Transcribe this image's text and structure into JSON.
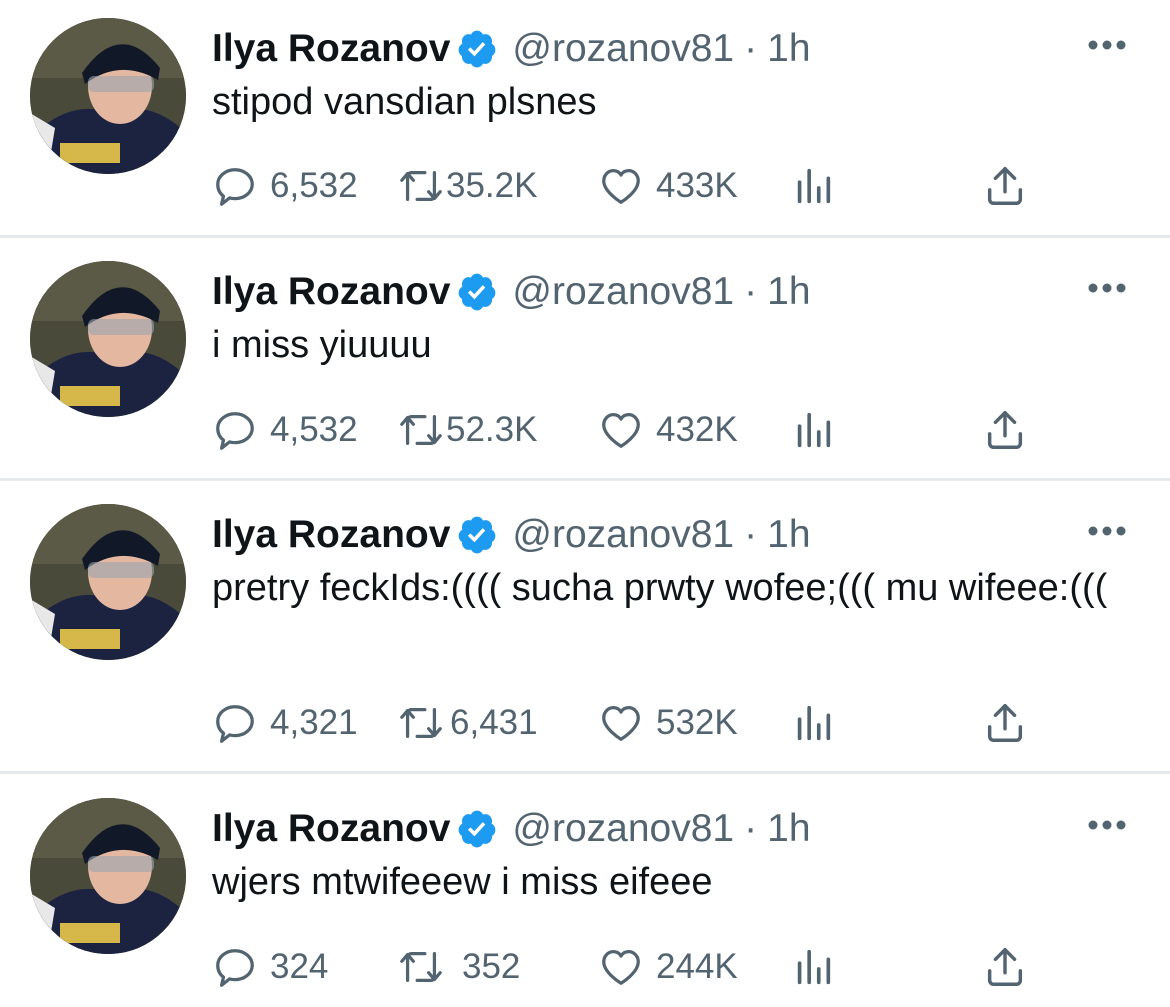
{
  "tweets": [
    {
      "name": "Ilya Rozanov",
      "handle": "@rozanov81",
      "separator": "·",
      "time": "1h",
      "text": "stipod vansdian plsnes",
      "replies": "6,532",
      "retweets": "35.2K",
      "likes": "433K"
    },
    {
      "name": "Ilya Rozanov",
      "handle": "@rozanov81",
      "separator": "·",
      "time": "1h",
      "text": "i miss yiuuuu",
      "replies": "4,532",
      "retweets": "52.3K",
      "likes": "432K"
    },
    {
      "name": "Ilya Rozanov",
      "handle": "@rozanov81",
      "separator": "·",
      "time": "1h",
      "text": "pretry feckIds:(((( sucha prwty wofee;((( mu wifeee:(((",
      "replies": "4,321",
      "retweets": "6,431",
      "likes": "532K"
    },
    {
      "name": "Ilya Rozanov",
      "handle": "@rozanov81",
      "separator": "·",
      "time": "1h",
      "text": "wjers mtwifeeew i miss eifeee",
      "replies": "324",
      "retweets": "352",
      "likes": "244K"
    }
  ],
  "icons": {
    "verified": "verified-badge-icon",
    "more": "more-options-icon",
    "reply": "reply-icon",
    "retweet": "retweet-icon",
    "like": "like-icon",
    "views": "views-chart-icon",
    "share": "share-icon"
  },
  "colors": {
    "text": "#0f1419",
    "secondary": "#536471",
    "verified": "#1d9bf0",
    "separator": "#e6e9eb"
  }
}
